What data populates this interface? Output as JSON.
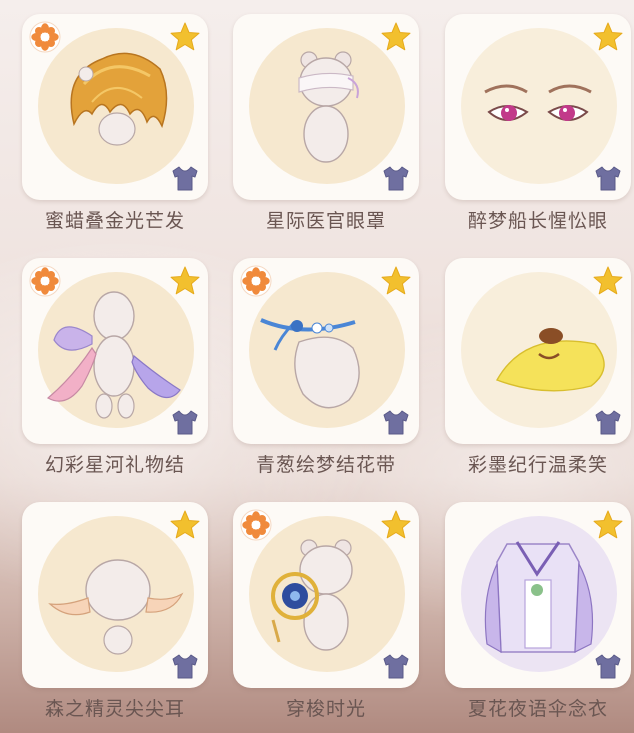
{
  "colors": {
    "badge_orange": "#f08a3c",
    "star_gold": "#f2c02e",
    "shirt_blue": "#6f6fa0",
    "label_text": "#6a5652",
    "card_bg": "#fdfaf6",
    "halo": "#f6e8cf"
  },
  "items": [
    {
      "name": "蜜蜡叠金光芒发",
      "badge_icon": "flower-badge-icon",
      "category_icon": "shirt-icon"
    },
    {
      "name": "星际医官眼罩",
      "badge_icon": null,
      "category_icon": "shirt-icon"
    },
    {
      "name": "醉梦船长惺忪眼",
      "badge_icon": null,
      "category_icon": "shirt-icon"
    },
    {
      "name": "幻彩星河礼物结",
      "badge_icon": "flower-badge-icon",
      "category_icon": "shirt-icon"
    },
    {
      "name": "青葱绘梦结花带",
      "badge_icon": "flower-badge-icon",
      "category_icon": "shirt-icon"
    },
    {
      "name": "彩墨纪行温柔笑",
      "badge_icon": null,
      "category_icon": "shirt-icon"
    },
    {
      "name": "森之精灵尖尖耳",
      "badge_icon": null,
      "category_icon": "shirt-icon"
    },
    {
      "name": "穿梭时光",
      "badge_icon": "flower-badge-icon",
      "category_icon": "shirt-icon"
    },
    {
      "name": "夏花夜语伞念衣",
      "badge_icon": null,
      "category_icon": "shirt-icon"
    }
  ]
}
